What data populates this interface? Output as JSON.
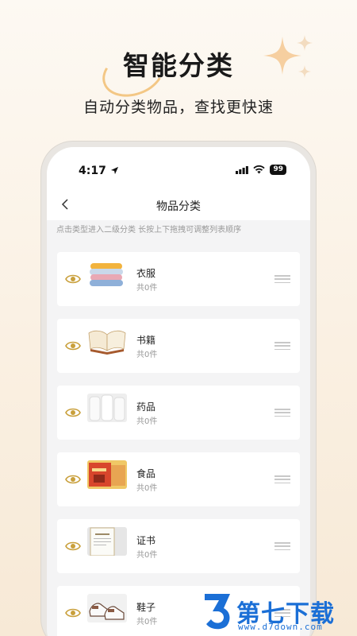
{
  "promo": {
    "title": "智能分类",
    "subtitle": "自动分类物品，查找更快速"
  },
  "status_bar": {
    "time": "4:17",
    "battery": "99"
  },
  "nav": {
    "back_icon": "chevron-left-icon",
    "title": "物品分类"
  },
  "hint": "点击类型进入二级分类 长按上下拖拽可调整列表顺序",
  "categories": [
    {
      "name": "衣服",
      "count": "共0件",
      "thumb": "clothes"
    },
    {
      "name": "书籍",
      "count": "共0件",
      "thumb": "book"
    },
    {
      "name": "药品",
      "count": "共0件",
      "thumb": "medicine"
    },
    {
      "name": "食品",
      "count": "共0件",
      "thumb": "food"
    },
    {
      "name": "证书",
      "count": "共0件",
      "thumb": "certificate"
    },
    {
      "name": "鞋子",
      "count": "共0件",
      "thumb": "shoes"
    }
  ],
  "watermark": {
    "name": "第七下载站",
    "url": "www.d7down.com"
  },
  "colors": {
    "accent_eye": "#c9a03c",
    "watermark": "#1b6fd6"
  }
}
